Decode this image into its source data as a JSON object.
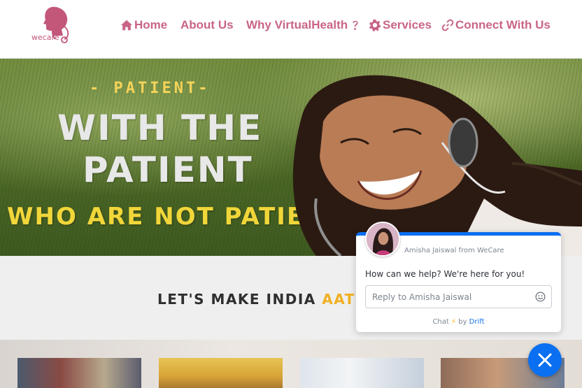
{
  "brand": {
    "logo_text": "wecare"
  },
  "nav": {
    "home": "Home",
    "about": "About Us",
    "why": "Why VirtualHealth",
    "services": "Services",
    "connect": "Connect With Us"
  },
  "hero": {
    "line1": "- PATIENT-",
    "line2": "WITH THE",
    "line3": "PATIENT",
    "line4": "WHO ARE NOT PATIENT"
  },
  "section": {
    "title_main": "LET'S MAKE INDIA ",
    "title_accent": "AATMA"
  },
  "chat": {
    "from": "Amisha Jaiswal from WeCare",
    "message": "How can we help? We're here for you!",
    "input_placeholder": "Reply to Amisha Jaiswal",
    "footer_chat": "Chat",
    "footer_by": " by ",
    "footer_brand": "Drift"
  },
  "colors": {
    "nav": "#c96489",
    "accent_yellow": "#f0b021",
    "chat_blue": "#0a6ff0"
  }
}
